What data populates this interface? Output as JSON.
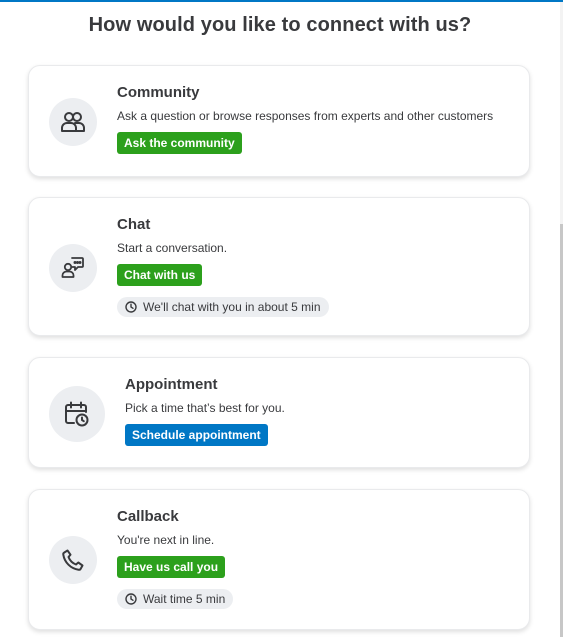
{
  "page": {
    "title": "How would you like to connect with us?"
  },
  "colors": {
    "accent_blue": "#0077c5",
    "action_green": "#2ca01c",
    "text": "#393a3d",
    "icon_bg": "#eceef1"
  },
  "cards": {
    "community": {
      "icon": "community-icon",
      "title": "Community",
      "description": "Ask a question or browse responses from experts and other customers",
      "button_label": "Ask the community"
    },
    "chat": {
      "icon": "chat-icon",
      "title": "Chat",
      "description": "Start a conversation.",
      "button_label": "Chat with us",
      "wait_text": "We'll chat with you in about 5 min"
    },
    "appointment": {
      "icon": "calendar-clock-icon",
      "title": "Appointment",
      "description": "Pick a time that’s best for you.",
      "button_label": "Schedule appointment"
    },
    "callback": {
      "icon": "phone-icon",
      "title": "Callback",
      "description": "You're next in line.",
      "button_label": "Have us call you",
      "wait_text": "Wait time 5 min"
    }
  }
}
